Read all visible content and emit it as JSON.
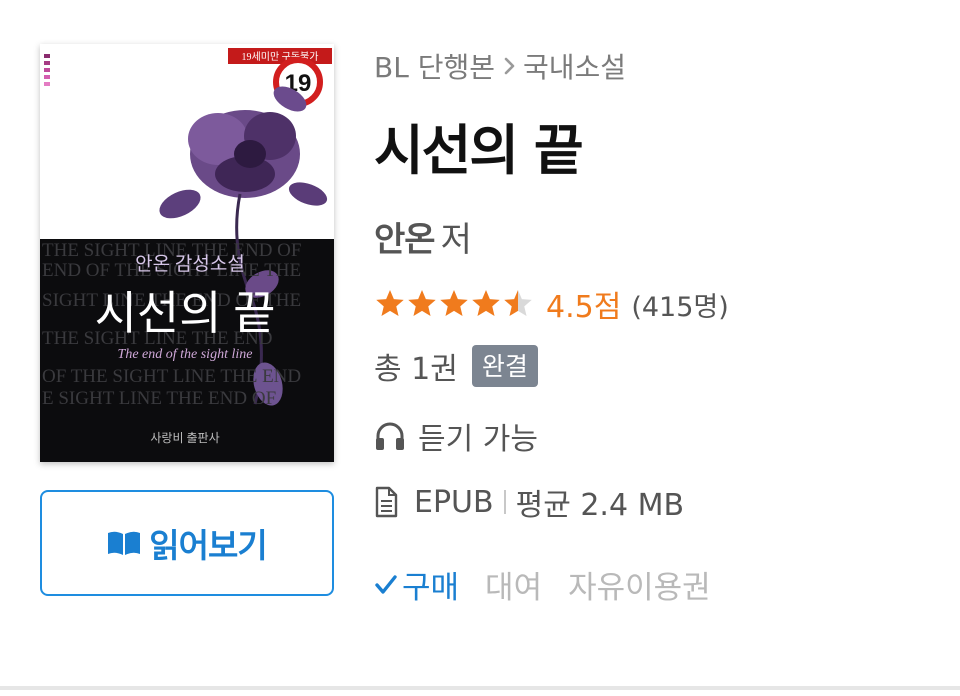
{
  "cover": {
    "age_badge": "19",
    "age_notice": "19세미만 구독불가",
    "subtitle_top": "안온 감성소설",
    "title_text": "시선의 끝",
    "english_title": "The end of the sight line",
    "publisher": "사랑비 출판사",
    "background_lines": [
      "THE SIGHT LINE THE END OF",
      "END OF THE SIGHT LINE THE",
      "SIGHT LINE THE END OF THE",
      "THE SIGHT LINE THE END",
      "OF THE SIGHT LINE THE END",
      "E SIGHT LINE THE END OF"
    ]
  },
  "read_button": {
    "label": "읽어보기",
    "icon": "open-book-icon"
  },
  "breadcrumb": {
    "first": "BL 단행본",
    "second": "국내소설",
    "separator_icon": "chevron-right-icon"
  },
  "book": {
    "title": "시선의 끝",
    "author": "안온",
    "author_suffix": "저"
  },
  "rating": {
    "stars_value": 4.5,
    "stars_max": 5,
    "score": "4.5점",
    "count": "(415명)"
  },
  "volume": {
    "text": "총 1권",
    "badge": "완결"
  },
  "listen": {
    "text": "듣기 가능",
    "icon": "headphones-icon"
  },
  "format": {
    "type": "EPUB",
    "size": "평균 2.4 MB",
    "icon": "document-icon"
  },
  "purchase_tabs": [
    {
      "label": "구매",
      "active": true
    },
    {
      "label": "대여",
      "active": false
    },
    {
      "label": "자유이용권",
      "active": false
    }
  ],
  "colors": {
    "accent_blue": "#1a7fd1",
    "rating_orange": "#f07b1d",
    "badge_gray": "#7c8591",
    "muted_text": "#555555"
  }
}
